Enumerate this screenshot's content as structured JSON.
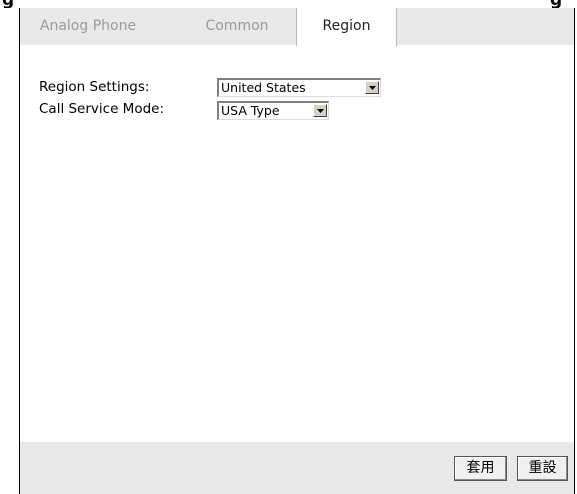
{
  "tabs": [
    {
      "label": "Analog Phone",
      "active": false
    },
    {
      "label": "Common",
      "active": false
    },
    {
      "label": "Region",
      "active": true
    }
  ],
  "form": {
    "region_settings": {
      "label": "Region Settings:",
      "value": "United States"
    },
    "call_service_mode": {
      "label": "Call Service Mode:",
      "value": "USA Type"
    }
  },
  "buttons": {
    "apply_label": "套用",
    "reset_label": "重設"
  },
  "icons": {
    "dropdown": "chevron-down-icon"
  },
  "colors": {
    "tab_bar_bg": "#e9e9e9",
    "inactive_tab_text": "#9a9a9a",
    "active_tab_bg": "#ffffff"
  }
}
